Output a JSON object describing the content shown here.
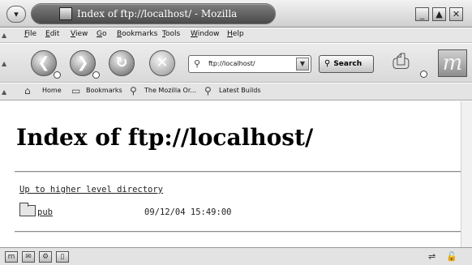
{
  "window": {
    "title": "Index of ftp://localhost/ - Mozilla",
    "menu_glyph": "▾",
    "minimize_glyph": "_",
    "maximize_glyph": "▲",
    "close_glyph": "✕"
  },
  "menubar": {
    "items": [
      {
        "label": "File"
      },
      {
        "label": "Edit"
      },
      {
        "label": "View"
      },
      {
        "label": "Go"
      },
      {
        "label": "Bookmarks"
      },
      {
        "label": "Tools"
      },
      {
        "label": "Window"
      },
      {
        "label": "Help"
      }
    ]
  },
  "navbar": {
    "back_glyph": "❮",
    "forward_glyph": "❯",
    "reload_glyph": "↻",
    "stop_glyph": "✕",
    "url_value": "ftp://localhost/",
    "url_icon": "⚲",
    "url_drop_glyph": "▼",
    "search_icon": "⚲",
    "search_label": "Search",
    "print_glyph": "⎙",
    "throbber_glyph": "m"
  },
  "personal_toolbar": {
    "items": [
      {
        "label": "Home",
        "icon": "⌂"
      },
      {
        "label": "Bookmarks",
        "icon": "▭"
      },
      {
        "label": "The Mozilla Or...",
        "icon": "⚲"
      },
      {
        "label": "Latest Builds",
        "icon": "⚲"
      }
    ]
  },
  "page": {
    "heading": "Index of ftp://localhost/",
    "parent_link": "Up to higher level directory",
    "entries": [
      {
        "name": "pub",
        "modified": "09/12/04 15:49:00"
      }
    ]
  },
  "statusbar": {
    "icons": [
      "m",
      "✉",
      "⚙",
      "▯"
    ],
    "right_glyphs": [
      "⇌",
      "🔓"
    ]
  }
}
